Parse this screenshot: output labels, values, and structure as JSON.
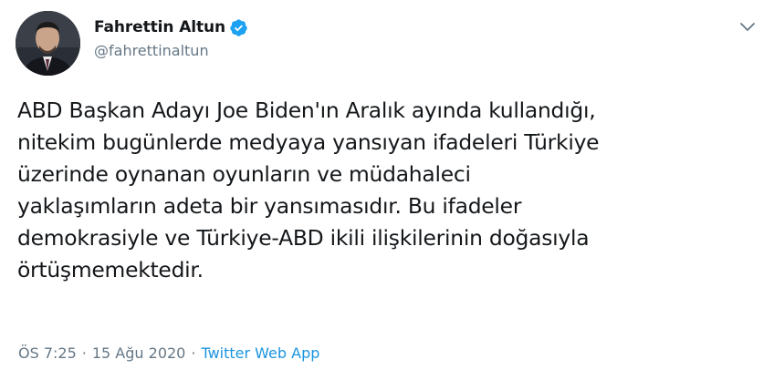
{
  "author": {
    "display_name": "Fahrettin Altun",
    "handle": "@fahrettinaltun",
    "verified": true
  },
  "icons": {
    "verified": "verified-badge-icon",
    "caret": "chevron-down-icon"
  },
  "tweet": {
    "lines": [
      "ABD Başkan Adayı Joe Biden'ın Aralık ayında kullandığı,",
      "nitekim bugünlerde medyaya yansıyan ifadeleri Türkiye",
      "üzerinde oynanan oyunların ve müdahaleci",
      "yaklaşımların adeta bir yansımasıdır. Bu ifadeler",
      "demokrasiyle ve Türkiye-ABD ikili ilişkilerinin doğasıyla",
      "örtüşmemektedir."
    ]
  },
  "meta": {
    "time": "ÖS 7:25",
    "separator": "·",
    "date": "15 Ağu 2020",
    "source": "Twitter Web App"
  },
  "colors": {
    "text": "#14171a",
    "secondary": "#657786",
    "link": "#1b95e0",
    "verified": "#1da1f2"
  }
}
